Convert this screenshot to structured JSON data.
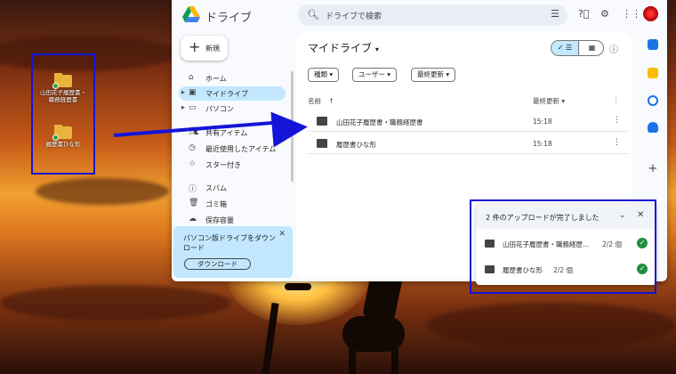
{
  "desktop": {
    "icons": [
      {
        "label_line1": "山田花子履歴書・",
        "label_line2": "職務経歴書"
      },
      {
        "label_line1": "履歴書ひな形",
        "label_line2": ""
      }
    ]
  },
  "app": {
    "brand": "ドライブ",
    "search_placeholder": "ドライブで検索",
    "icons": {
      "search": "search-icon",
      "tune": "tune-icon",
      "help": "help-icon",
      "settings": "gear-icon",
      "apps": "apps-icon"
    }
  },
  "sidebar": {
    "new_label": "新規",
    "items": [
      {
        "label": "ホーム",
        "icon": "home-icon",
        "active": false
      },
      {
        "label": "マイドライブ",
        "icon": "drive-icon",
        "active": true
      },
      {
        "label": "パソコン",
        "icon": "computer-icon",
        "active": false
      },
      {
        "label": "共有アイテム",
        "icon": "shared-icon",
        "active": false
      },
      {
        "label": "最近使用したアイテム",
        "icon": "clock-icon",
        "active": false
      },
      {
        "label": "スター付き",
        "icon": "star-icon",
        "active": false
      },
      {
        "label": "スパム",
        "icon": "spam-icon",
        "active": false
      },
      {
        "label": "ゴミ箱",
        "icon": "trash-icon",
        "active": false
      },
      {
        "label": "保存容量",
        "icon": "cloud-icon",
        "active": false
      }
    ],
    "promo_text": "パソコン版ドライブをダウンロード",
    "promo_button": "ダウンロード"
  },
  "main": {
    "title": "マイドライブ",
    "filters": [
      "種類",
      "ユーザー",
      "最終更新"
    ],
    "col_name": "名前",
    "col_modified": "最終更新",
    "files": [
      {
        "name": "山田花子履歴書・職務経歴書",
        "modified": "15:18"
      },
      {
        "name": "履歴書ひな形",
        "modified": "15:18"
      }
    ]
  },
  "upload": {
    "header": "2 件のアップロードが完了しました",
    "items": [
      {
        "name": "山田花子履歴書・職務経歴...",
        "count": "2/2 個"
      },
      {
        "name": "履歴書ひな形",
        "count": "2/2 個"
      }
    ]
  }
}
